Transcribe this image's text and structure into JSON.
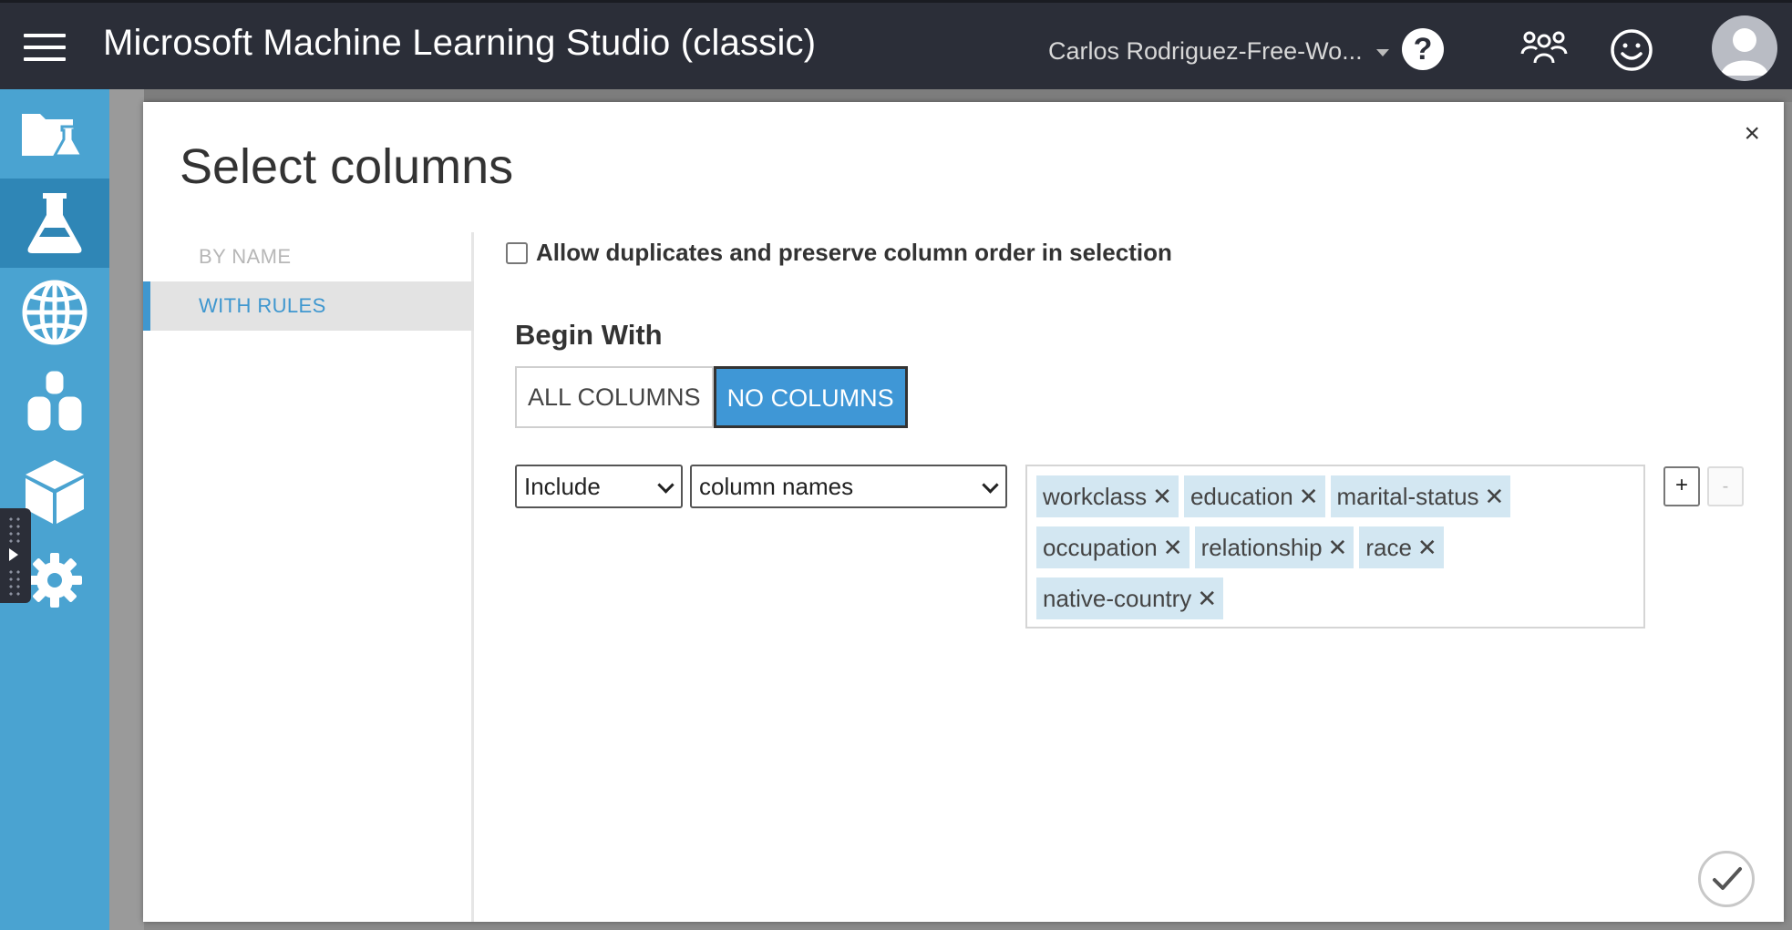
{
  "header": {
    "app_title": "Microsoft Machine Learning Studio (classic)",
    "workspace": "Carlos Rodriguez-Free-Wo...",
    "help_glyph": "?"
  },
  "nav": {
    "items": [
      {
        "icon": "projects-icon"
      },
      {
        "icon": "experiments-icon",
        "active": true
      },
      {
        "icon": "web-services-icon"
      },
      {
        "icon": "datasets-icon"
      },
      {
        "icon": "trained-models-icon"
      },
      {
        "icon": "settings-icon"
      }
    ]
  },
  "dialog": {
    "title": "Select columns",
    "close_glyph": "×",
    "tabs": [
      {
        "label": "BY NAME",
        "active": false
      },
      {
        "label": "WITH RULES",
        "active": true
      }
    ],
    "allow_duplicates_label": "Allow duplicates and preserve column order in selection",
    "allow_duplicates_checked": false,
    "begin_with": {
      "label": "Begin With",
      "options": [
        "ALL COLUMNS",
        "NO COLUMNS"
      ],
      "selected": "NO COLUMNS"
    },
    "rule": {
      "action": "Include",
      "type": "column names",
      "columns": [
        "workclass",
        "education",
        "marital-status",
        "occupation",
        "relationship",
        "race",
        "native-country"
      ],
      "remove_glyph": "✕"
    },
    "add_rule_label": "+",
    "remove_rule_label": "-"
  },
  "colors": {
    "topbar": "#2b2e38",
    "nav": "#4aa3d1",
    "accent": "#3f97d6",
    "tag": "#d3e7f2"
  }
}
